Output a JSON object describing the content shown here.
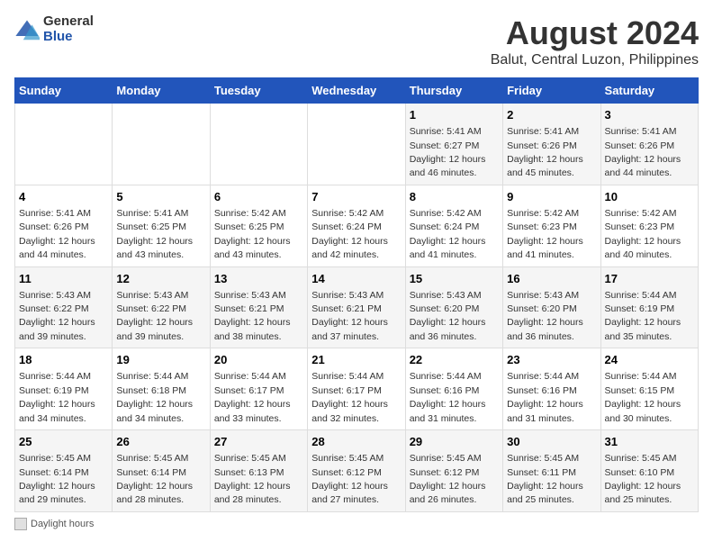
{
  "header": {
    "logo": {
      "general": "General",
      "blue": "Blue"
    },
    "title": "August 2024",
    "subtitle": "Balut, Central Luzon, Philippines"
  },
  "days_of_week": [
    "Sunday",
    "Monday",
    "Tuesday",
    "Wednesday",
    "Thursday",
    "Friday",
    "Saturday"
  ],
  "weeks": [
    [
      {
        "day": "",
        "info": ""
      },
      {
        "day": "",
        "info": ""
      },
      {
        "day": "",
        "info": ""
      },
      {
        "day": "",
        "info": ""
      },
      {
        "day": "1",
        "info": "Sunrise: 5:41 AM\nSunset: 6:27 PM\nDaylight: 12 hours\nand 46 minutes."
      },
      {
        "day": "2",
        "info": "Sunrise: 5:41 AM\nSunset: 6:26 PM\nDaylight: 12 hours\nand 45 minutes."
      },
      {
        "day": "3",
        "info": "Sunrise: 5:41 AM\nSunset: 6:26 PM\nDaylight: 12 hours\nand 44 minutes."
      }
    ],
    [
      {
        "day": "4",
        "info": "Sunrise: 5:41 AM\nSunset: 6:26 PM\nDaylight: 12 hours\nand 44 minutes."
      },
      {
        "day": "5",
        "info": "Sunrise: 5:41 AM\nSunset: 6:25 PM\nDaylight: 12 hours\nand 43 minutes."
      },
      {
        "day": "6",
        "info": "Sunrise: 5:42 AM\nSunset: 6:25 PM\nDaylight: 12 hours\nand 43 minutes."
      },
      {
        "day": "7",
        "info": "Sunrise: 5:42 AM\nSunset: 6:24 PM\nDaylight: 12 hours\nand 42 minutes."
      },
      {
        "day": "8",
        "info": "Sunrise: 5:42 AM\nSunset: 6:24 PM\nDaylight: 12 hours\nand 41 minutes."
      },
      {
        "day": "9",
        "info": "Sunrise: 5:42 AM\nSunset: 6:23 PM\nDaylight: 12 hours\nand 41 minutes."
      },
      {
        "day": "10",
        "info": "Sunrise: 5:42 AM\nSunset: 6:23 PM\nDaylight: 12 hours\nand 40 minutes."
      }
    ],
    [
      {
        "day": "11",
        "info": "Sunrise: 5:43 AM\nSunset: 6:22 PM\nDaylight: 12 hours\nand 39 minutes."
      },
      {
        "day": "12",
        "info": "Sunrise: 5:43 AM\nSunset: 6:22 PM\nDaylight: 12 hours\nand 39 minutes."
      },
      {
        "day": "13",
        "info": "Sunrise: 5:43 AM\nSunset: 6:21 PM\nDaylight: 12 hours\nand 38 minutes."
      },
      {
        "day": "14",
        "info": "Sunrise: 5:43 AM\nSunset: 6:21 PM\nDaylight: 12 hours\nand 37 minutes."
      },
      {
        "day": "15",
        "info": "Sunrise: 5:43 AM\nSunset: 6:20 PM\nDaylight: 12 hours\nand 36 minutes."
      },
      {
        "day": "16",
        "info": "Sunrise: 5:43 AM\nSunset: 6:20 PM\nDaylight: 12 hours\nand 36 minutes."
      },
      {
        "day": "17",
        "info": "Sunrise: 5:44 AM\nSunset: 6:19 PM\nDaylight: 12 hours\nand 35 minutes."
      }
    ],
    [
      {
        "day": "18",
        "info": "Sunrise: 5:44 AM\nSunset: 6:19 PM\nDaylight: 12 hours\nand 34 minutes."
      },
      {
        "day": "19",
        "info": "Sunrise: 5:44 AM\nSunset: 6:18 PM\nDaylight: 12 hours\nand 34 minutes."
      },
      {
        "day": "20",
        "info": "Sunrise: 5:44 AM\nSunset: 6:17 PM\nDaylight: 12 hours\nand 33 minutes."
      },
      {
        "day": "21",
        "info": "Sunrise: 5:44 AM\nSunset: 6:17 PM\nDaylight: 12 hours\nand 32 minutes."
      },
      {
        "day": "22",
        "info": "Sunrise: 5:44 AM\nSunset: 6:16 PM\nDaylight: 12 hours\nand 31 minutes."
      },
      {
        "day": "23",
        "info": "Sunrise: 5:44 AM\nSunset: 6:16 PM\nDaylight: 12 hours\nand 31 minutes."
      },
      {
        "day": "24",
        "info": "Sunrise: 5:44 AM\nSunset: 6:15 PM\nDaylight: 12 hours\nand 30 minutes."
      }
    ],
    [
      {
        "day": "25",
        "info": "Sunrise: 5:45 AM\nSunset: 6:14 PM\nDaylight: 12 hours\nand 29 minutes."
      },
      {
        "day": "26",
        "info": "Sunrise: 5:45 AM\nSunset: 6:14 PM\nDaylight: 12 hours\nand 28 minutes."
      },
      {
        "day": "27",
        "info": "Sunrise: 5:45 AM\nSunset: 6:13 PM\nDaylight: 12 hours\nand 28 minutes."
      },
      {
        "day": "28",
        "info": "Sunrise: 5:45 AM\nSunset: 6:12 PM\nDaylight: 12 hours\nand 27 minutes."
      },
      {
        "day": "29",
        "info": "Sunrise: 5:45 AM\nSunset: 6:12 PM\nDaylight: 12 hours\nand 26 minutes."
      },
      {
        "day": "30",
        "info": "Sunrise: 5:45 AM\nSunset: 6:11 PM\nDaylight: 12 hours\nand 25 minutes."
      },
      {
        "day": "31",
        "info": "Sunrise: 5:45 AM\nSunset: 6:10 PM\nDaylight: 12 hours\nand 25 minutes."
      }
    ]
  ],
  "footer": {
    "legend_label": "Daylight hours"
  }
}
